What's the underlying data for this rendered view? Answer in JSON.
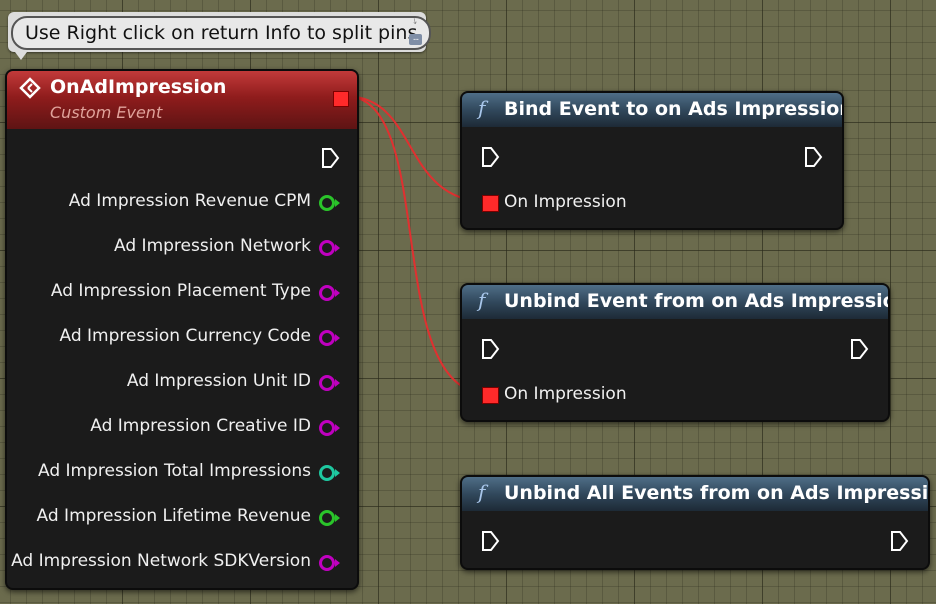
{
  "comment": {
    "text": "Use Right click on return Info to split pins",
    "pin_icon": "pin-icon",
    "more_icon": "ellipsis-icon",
    "more_text": "..."
  },
  "event_node": {
    "title": "OnAdImpression",
    "subtitle": "Custom Event",
    "icon": "event-diamond-icon",
    "header_color": "#a52a2a",
    "delegate_pin_color": "#ff2a2a",
    "outputs": [
      {
        "label": "Ad Impression Revenue CPM",
        "color": "#2ac42a"
      },
      {
        "label": "Ad Impression Network",
        "color": "#c000c0"
      },
      {
        "label": "Ad Impression Placement Type",
        "color": "#c000c0"
      },
      {
        "label": "Ad Impression Currency Code",
        "color": "#c000c0"
      },
      {
        "label": "Ad Impression Unit ID",
        "color": "#c000c0"
      },
      {
        "label": "Ad Impression Creative ID",
        "color": "#c000c0"
      },
      {
        "label": "Ad Impression Total Impressions",
        "color": "#1ec8a0"
      },
      {
        "label": "Ad Impression Lifetime Revenue",
        "color": "#2ac42a"
      },
      {
        "label": "Ad Impression Network SDKVersion",
        "color": "#c000c0"
      }
    ]
  },
  "function_nodes": [
    {
      "title": "Bind Event to on Ads Impression",
      "input_label": "On Impression"
    },
    {
      "title": "Unbind Event from on Ads Impression",
      "input_label": "On Impression"
    },
    {
      "title": "Unbind All Events from on Ads Impression"
    }
  ],
  "function_icon": "f",
  "wire_color": "#e03030"
}
